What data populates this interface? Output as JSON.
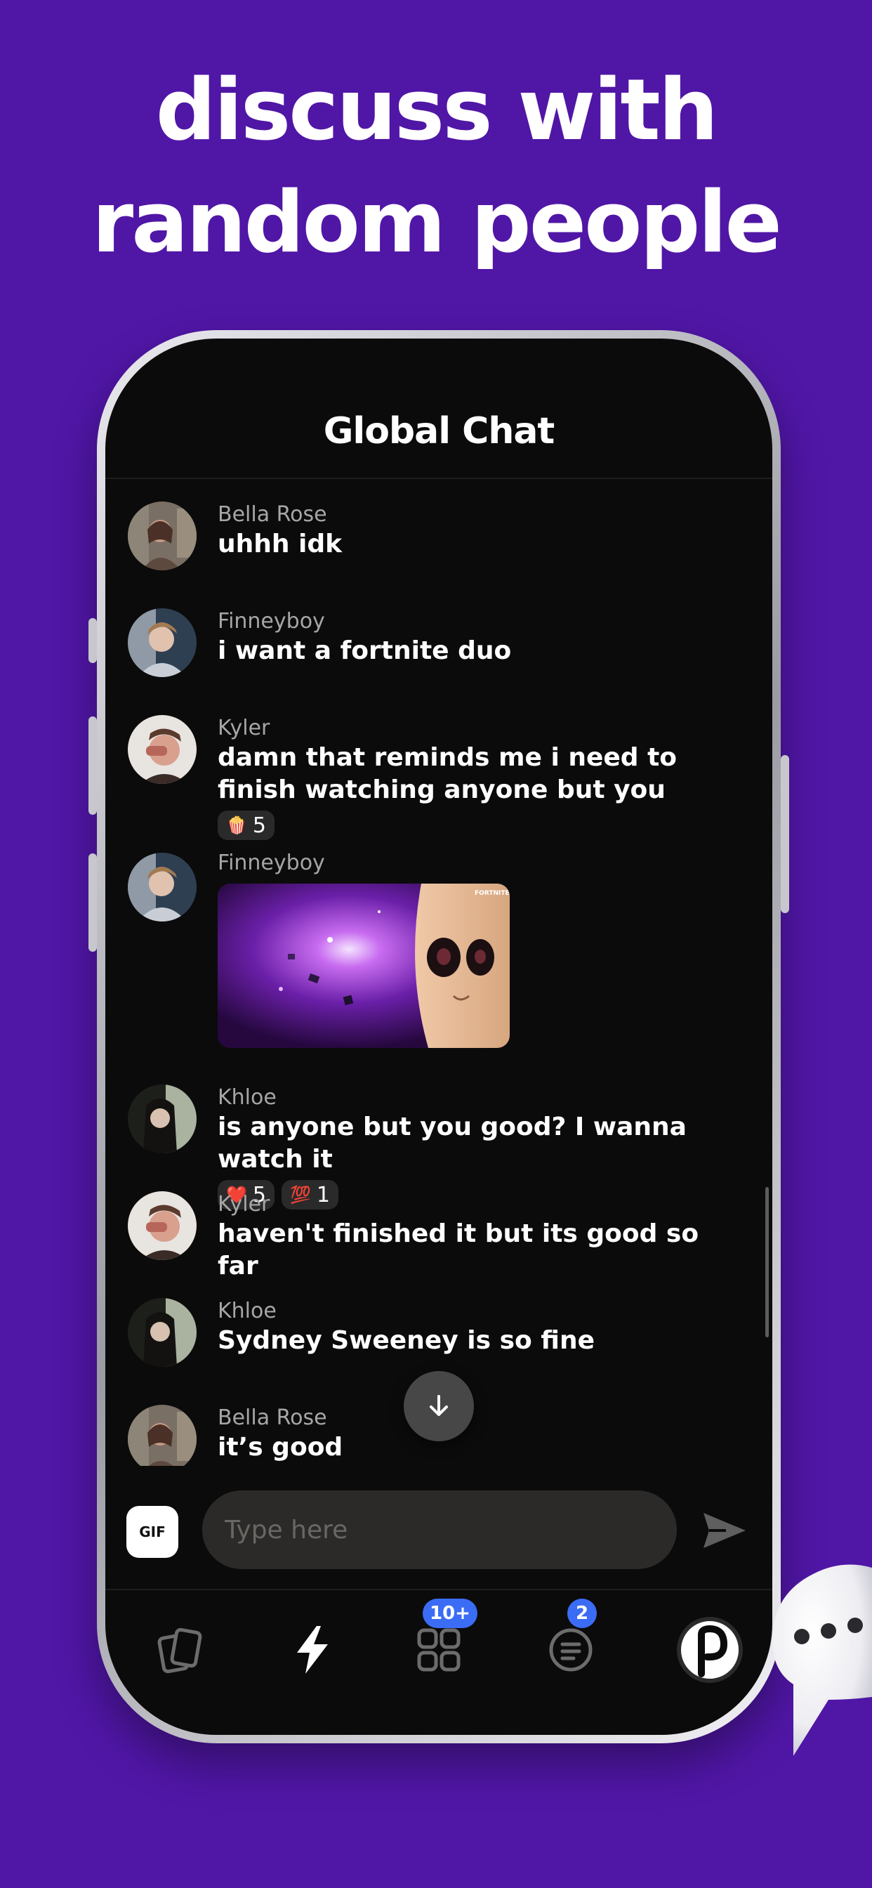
{
  "headline": {
    "line1": "discuss with",
    "line2": "random people"
  },
  "chat": {
    "title": "Global Chat",
    "messages": [
      {
        "author": "Bella Rose",
        "text": "uhhh idk"
      },
      {
        "author": "Finneyboy",
        "text": "i want a fortnite duo"
      },
      {
        "author": "Kyler",
        "text": "damn that reminds me i need to finish watching anyone but you",
        "reactions": [
          {
            "emoji": "🍿",
            "count": "5"
          }
        ]
      },
      {
        "author": "Finneyboy",
        "gif_label": "FORTNITE"
      },
      {
        "author": "Khloe",
        "text": "is anyone but you good? I wanna watch it",
        "reactions": [
          {
            "emoji": "❤️",
            "count": "5"
          },
          {
            "emoji": "💯",
            "count": "1"
          }
        ]
      },
      {
        "author": "Kyler",
        "text": "haven't finished it but its good so far"
      },
      {
        "author": "Khloe",
        "text": "Sydney Sweeney is so fine"
      },
      {
        "author": "Bella Rose",
        "text": "it’s good"
      }
    ]
  },
  "composer": {
    "gif_label": "GIF",
    "placeholder": "Type here"
  },
  "tabbar": {
    "tabs": [
      {
        "icon": "cards-icon"
      },
      {
        "icon": "lightning-icon"
      },
      {
        "icon": "grid-icon",
        "badge": "10+"
      },
      {
        "icon": "messages-icon",
        "badge": "2"
      },
      {
        "icon": "profile-avatar-icon"
      }
    ]
  },
  "colors": {
    "background": "#5016a6",
    "screen": "#0b0b0b",
    "badge": "#3b6cf5"
  }
}
